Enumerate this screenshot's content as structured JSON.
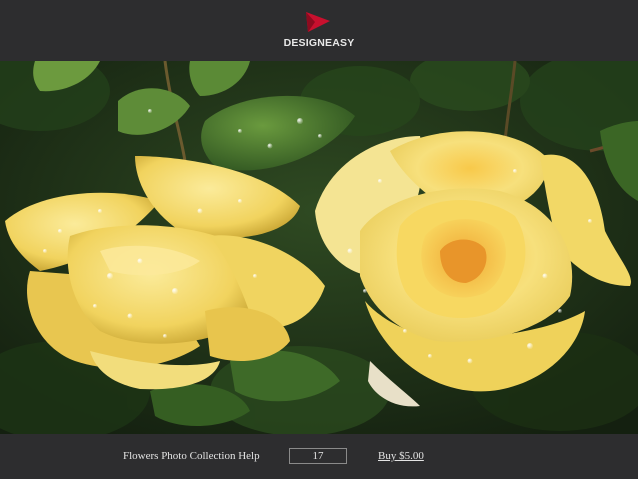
{
  "header": {
    "logo_icon": "red-play-triangle-icon",
    "brand_name": "DESIGNEASY",
    "accent_color": "#c8102e"
  },
  "photo": {
    "subject": "two yellow roses with water droplets among green leaves"
  },
  "footer": {
    "title": "Flowers Photo Collection Help",
    "page_value": "17",
    "buy_label": "Buy $5.00"
  }
}
